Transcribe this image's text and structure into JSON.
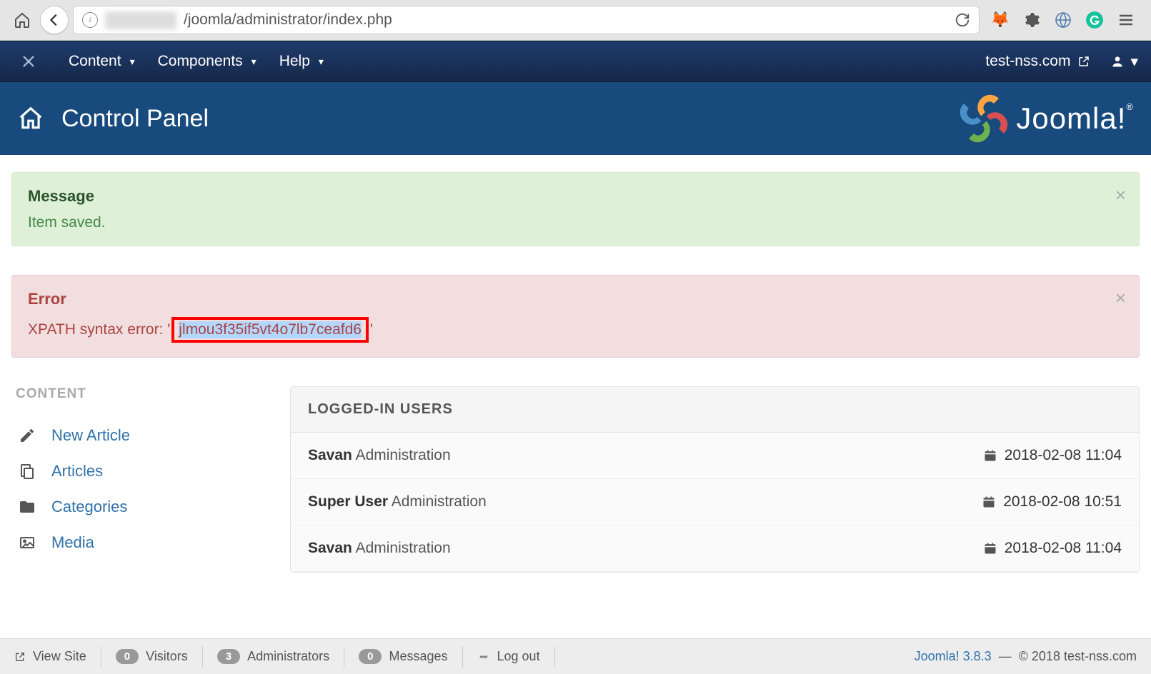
{
  "browser": {
    "url_obscured": "xxxxxxxx",
    "url_path": "/joomla/administrator/index.php"
  },
  "nav": {
    "items": [
      "Content",
      "Components",
      "Help"
    ],
    "site_label": "test-nss.com"
  },
  "header": {
    "title": "Control Panel",
    "brand": "Joomla!"
  },
  "alerts": {
    "success": {
      "title": "Message",
      "text": "Item saved."
    },
    "error": {
      "title": "Error",
      "prefix": "XPATH syntax error: '",
      "code": "jlmou3f35if5vt4o7lb7ceafd6",
      "suffix": "'"
    }
  },
  "quick": {
    "heading": "CONTENT",
    "items": [
      {
        "icon": "pencil",
        "label": "New Article"
      },
      {
        "icon": "copy",
        "label": "Articles"
      },
      {
        "icon": "folder",
        "label": "Categories"
      },
      {
        "icon": "image",
        "label": "Media"
      }
    ]
  },
  "module": {
    "title": "LOGGED-IN USERS",
    "rows": [
      {
        "name": "Savan",
        "role": "Administration",
        "time": "2018-02-08 11:04"
      },
      {
        "name": "Super User",
        "role": "Administration",
        "time": "2018-02-08 10:51"
      },
      {
        "name": "Savan",
        "role": "Administration",
        "time": "2018-02-08 11:04"
      }
    ]
  },
  "footer": {
    "view_site": "View Site",
    "visitors_count": "0",
    "visitors_label": "Visitors",
    "admins_count": "3",
    "admins_label": "Administrators",
    "msgs_count": "0",
    "msgs_label": "Messages",
    "logout": "Log out",
    "version": "Joomla! 3.8.3",
    "copyright": "© 2018 test-nss.com"
  }
}
